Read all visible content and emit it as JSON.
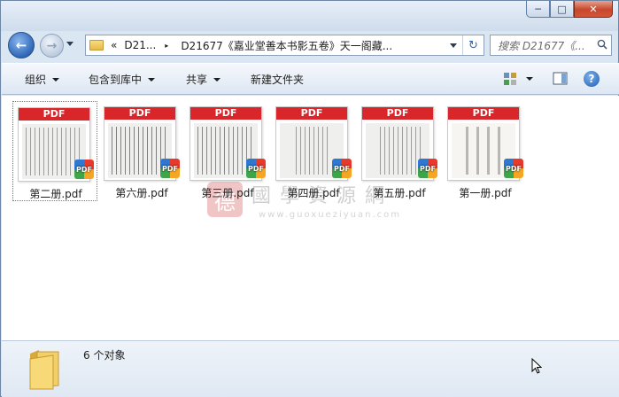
{
  "window": {
    "controls": {
      "minimize": "─",
      "maximize": "□",
      "close": "✕"
    }
  },
  "nav": {
    "back_glyph": "←",
    "forward_glyph": "→",
    "address": {
      "prefix": "«",
      "segment1": "D21...",
      "separator": "▸",
      "path": "D21677《嘉业堂善本书影五卷》天一阁藏..."
    },
    "refresh_glyph": "↻",
    "search_placeholder": "搜索 D21677《..."
  },
  "toolbar": {
    "organize": "组织",
    "include_in_library": "包含到库中",
    "share": "共享",
    "new_folder": "新建文件夹",
    "help": "?"
  },
  "files": [
    {
      "name": "第二册.pdf",
      "badge": "PDF",
      "bar": "PDF",
      "selected": true
    },
    {
      "name": "第六册.pdf",
      "badge": "PDF",
      "bar": "PDF",
      "selected": false
    },
    {
      "name": "第三册.pdf",
      "badge": "PDF",
      "bar": "PDF",
      "selected": false
    },
    {
      "name": "第四册.pdf",
      "badge": "PDF",
      "bar": "PDF",
      "selected": false
    },
    {
      "name": "第五册.pdf",
      "badge": "PDF",
      "bar": "PDF",
      "selected": false
    },
    {
      "name": "第一册.pdf",
      "badge": "PDF",
      "bar": "PDF",
      "selected": false
    }
  ],
  "watermark": {
    "seal": "德",
    "title": "國學資源網",
    "url": "www.guoxueziyuan.com"
  },
  "status": {
    "count_text": "6 个对象"
  },
  "colors": {
    "pdf_red": "#d8262b",
    "toolbar_bg": "#dde7f3",
    "details_bg": "#e6edf6"
  }
}
